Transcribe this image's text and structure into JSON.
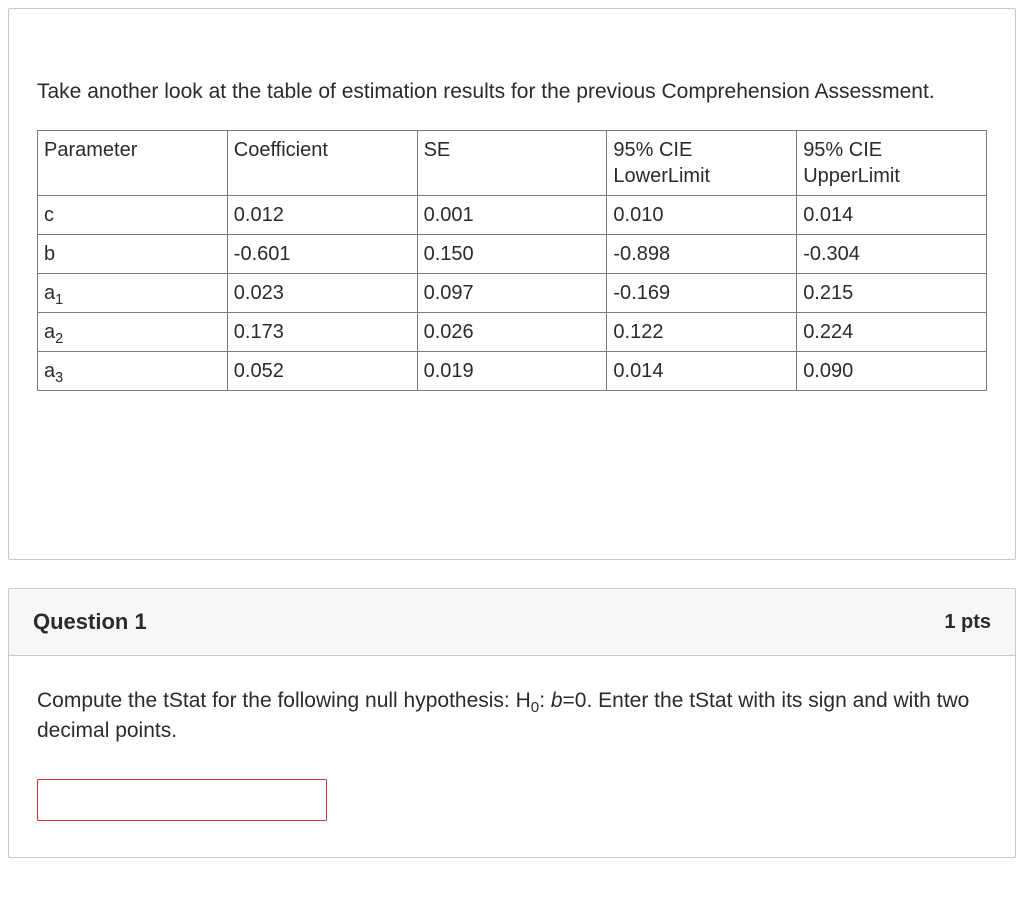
{
  "intro": "Take another look at the table of estimation results for the previous Comprehension Assessment.",
  "table": {
    "headers": {
      "param": "Parameter",
      "coef": "Coefficient",
      "se": "SE",
      "ll_a": "95% CIE",
      "ll_b": "LowerLimit",
      "ul_a": "95% CIE",
      "ul_b": "UpperLimit"
    },
    "rows": [
      {
        "param_base": "c",
        "param_sub": "",
        "coef": "0.012",
        "se": "0.001",
        "ll": "0.010",
        "ul": "0.014"
      },
      {
        "param_base": "b",
        "param_sub": "",
        "coef": "-0.601",
        "se": "0.150",
        "ll": "-0.898",
        "ul": "-0.304"
      },
      {
        "param_base": "a",
        "param_sub": "1",
        "coef": "0.023",
        "se": "0.097",
        "ll": "-0.169",
        "ul": "0.215"
      },
      {
        "param_base": "a",
        "param_sub": "2",
        "coef": "0.173",
        "se": "0.026",
        "ll": "0.122",
        "ul": "0.224"
      },
      {
        "param_base": "a",
        "param_sub": "3",
        "coef": "0.052",
        "se": "0.019",
        "ll": "0.014",
        "ul": "0.090"
      }
    ]
  },
  "question": {
    "title": "Question 1",
    "points": "1 pts",
    "prompt_pre": "Compute the tStat for the following null hypothesis: H",
    "prompt_sub": "0",
    "prompt_mid": ": ",
    "prompt_var": "b",
    "prompt_post": "=0. Enter the tStat with its sign and with two decimal points.",
    "answer_value": ""
  },
  "chart_data": {
    "type": "table",
    "title": "Estimation results",
    "columns": [
      "Parameter",
      "Coefficient",
      "SE",
      "95% CIE LowerLimit",
      "95% CIE UpperLimit"
    ],
    "rows": [
      [
        "c",
        0.012,
        0.001,
        0.01,
        0.014
      ],
      [
        "b",
        -0.601,
        0.15,
        -0.898,
        -0.304
      ],
      [
        "a1",
        0.023,
        0.097,
        -0.169,
        0.215
      ],
      [
        "a2",
        0.173,
        0.026,
        0.122,
        0.224
      ],
      [
        "a3",
        0.052,
        0.019,
        0.014,
        0.09
      ]
    ]
  }
}
